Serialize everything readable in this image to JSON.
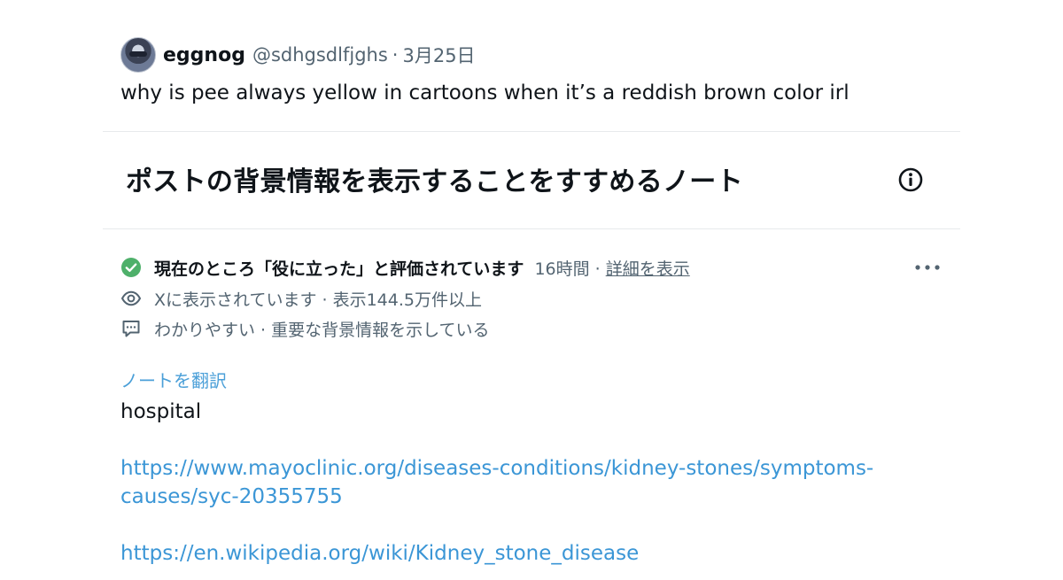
{
  "tweet": {
    "display_name": "eggnog",
    "handle": "@sdhgsdlfjghs",
    "separator": "·",
    "date": "3月25日",
    "text": "why is pee always yellow in cartoons when it’s a reddish brown color irl"
  },
  "note": {
    "title": "ポストの背景情報を表示することをすすめるノート",
    "status": "現在のところ「役に立った」と評価されています",
    "time": "16時間 ·",
    "details_link": "詳細を表示",
    "views": "Xに表示されています · 表示144.5万件以上",
    "helpful_reasons": "わかりやすい · 重要な背景情報を示している",
    "translate_label": "ノートを翻訳",
    "body_text": "hospital",
    "links": [
      {
        "line1": "https://www.mayoclinic.org/diseases-conditions/kidney-stones/symptoms-",
        "line2": "causes/syc-20355755"
      },
      {
        "line1": "https://en.wikipedia.org/wiki/Kidney_stone_disease"
      }
    ]
  },
  "icons": {
    "check": "check-circle-icon",
    "info": "info-icon",
    "more": "more-icon",
    "eye": "eye-icon",
    "comment": "comment-icon"
  },
  "colors": {
    "link_blue": "#3b96d6",
    "check_green": "#4eb06a",
    "muted_text": "#536471"
  }
}
